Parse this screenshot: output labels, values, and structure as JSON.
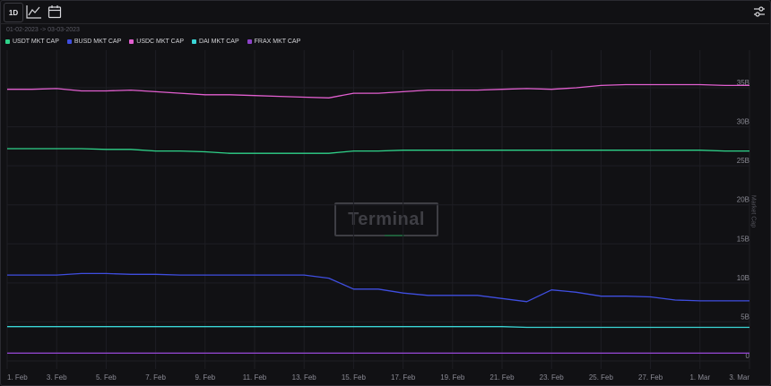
{
  "toolbar": {
    "range_label": "1D",
    "chart_icon": "line-chart-icon",
    "calendar_icon": "calendar-icon",
    "settings_icon": "settings-sliders-icon"
  },
  "date_range": "01-02-2023 -> 03-03-2023",
  "watermark": "Terminal",
  "colors": {
    "background": "#111114",
    "grid": "#1e1e24",
    "usdt": "#2fd38a",
    "busd": "#3f4ee0",
    "usdc": "#e25fd0",
    "dai": "#3ad6d6",
    "frax": "#8e43c9"
  },
  "chart_data": {
    "type": "line",
    "title": "",
    "xlabel": "",
    "ylabel": "Market Cap",
    "ylim": [
      0,
      38
    ],
    "yticks": [
      0,
      5,
      10,
      15,
      20,
      25,
      30,
      35
    ],
    "ytick_labels": [
      "0",
      "5B",
      "10B",
      "15B",
      "20B",
      "25B",
      "30B",
      "35B"
    ],
    "legend_position": "top-left",
    "grid": true,
    "x": [
      "1. Feb",
      "2. Feb",
      "3. Feb",
      "4. Feb",
      "5. Feb",
      "6. Feb",
      "7. Feb",
      "8. Feb",
      "9. Feb",
      "10. Feb",
      "11. Feb",
      "12. Feb",
      "13. Feb",
      "14. Feb",
      "15. Feb",
      "16. Feb",
      "17. Feb",
      "18. Feb",
      "19. Feb",
      "20. Feb",
      "21. Feb",
      "22. Feb",
      "23. Feb",
      "24. Feb",
      "25. Feb",
      "26. Feb",
      "27. Feb",
      "28. Feb",
      "1. Mar",
      "2. Mar",
      "3. Mar"
    ],
    "xtick_labels": [
      "1. Feb",
      "3. Feb",
      "5. Feb",
      "7. Feb",
      "9. Feb",
      "11. Feb",
      "13. Feb",
      "15. Feb",
      "17. Feb",
      "19. Feb",
      "21. Feb",
      "23. Feb",
      "25. Feb",
      "27. Feb",
      "1. Mar",
      "3. Mar"
    ],
    "series": [
      {
        "name": "USDT MKT CAP",
        "color": "#2fd38a",
        "values": [
          27.2,
          27.2,
          27.2,
          27.2,
          27.1,
          27.1,
          26.9,
          26.9,
          26.8,
          26.6,
          26.6,
          26.6,
          26.6,
          26.6,
          26.9,
          26.9,
          27.0,
          27.0,
          27.0,
          27.0,
          27.0,
          27.0,
          27.0,
          27.0,
          27.0,
          27.0,
          27.0,
          27.0,
          27.0,
          26.9,
          26.9
        ]
      },
      {
        "name": "BUSD MKT CAP",
        "color": "#3f4ee0",
        "values": [
          11.0,
          11.0,
          11.0,
          11.2,
          11.2,
          11.1,
          11.1,
          11.0,
          11.0,
          11.0,
          11.0,
          11.0,
          11.0,
          10.6,
          9.2,
          9.2,
          8.7,
          8.4,
          8.4,
          8.4,
          8.0,
          7.6,
          9.1,
          8.8,
          8.3,
          8.3,
          8.2,
          7.8,
          7.7,
          7.7,
          7.7
        ]
      },
      {
        "name": "USDC MKT CAP",
        "color": "#e25fd0",
        "values": [
          34.8,
          34.8,
          34.9,
          34.6,
          34.6,
          34.7,
          34.5,
          34.3,
          34.1,
          34.1,
          34.0,
          33.9,
          33.8,
          33.7,
          34.3,
          34.3,
          34.5,
          34.7,
          34.7,
          34.7,
          34.8,
          34.9,
          34.8,
          35.0,
          35.3,
          35.4,
          35.4,
          35.4,
          35.4,
          35.3,
          35.3
        ]
      },
      {
        "name": "DAI MKT CAP",
        "color": "#3ad6d6",
        "values": [
          4.4,
          4.4,
          4.4,
          4.4,
          4.4,
          4.4,
          4.4,
          4.4,
          4.4,
          4.4,
          4.4,
          4.4,
          4.4,
          4.4,
          4.4,
          4.4,
          4.4,
          4.4,
          4.4,
          4.4,
          4.4,
          4.3,
          4.3,
          4.3,
          4.3,
          4.3,
          4.3,
          4.3,
          4.3,
          4.3,
          4.3
        ]
      },
      {
        "name": "FRAX MKT CAP",
        "color": "#8e43c9",
        "values": [
          1.0,
          1.0,
          1.0,
          1.0,
          1.0,
          1.0,
          1.0,
          1.0,
          1.0,
          1.0,
          1.0,
          1.0,
          1.0,
          1.0,
          1.0,
          1.0,
          1.0,
          1.0,
          1.0,
          1.0,
          1.0,
          1.0,
          1.0,
          1.0,
          1.0,
          1.0,
          1.0,
          1.0,
          1.0,
          1.0,
          1.0
        ]
      }
    ]
  }
}
